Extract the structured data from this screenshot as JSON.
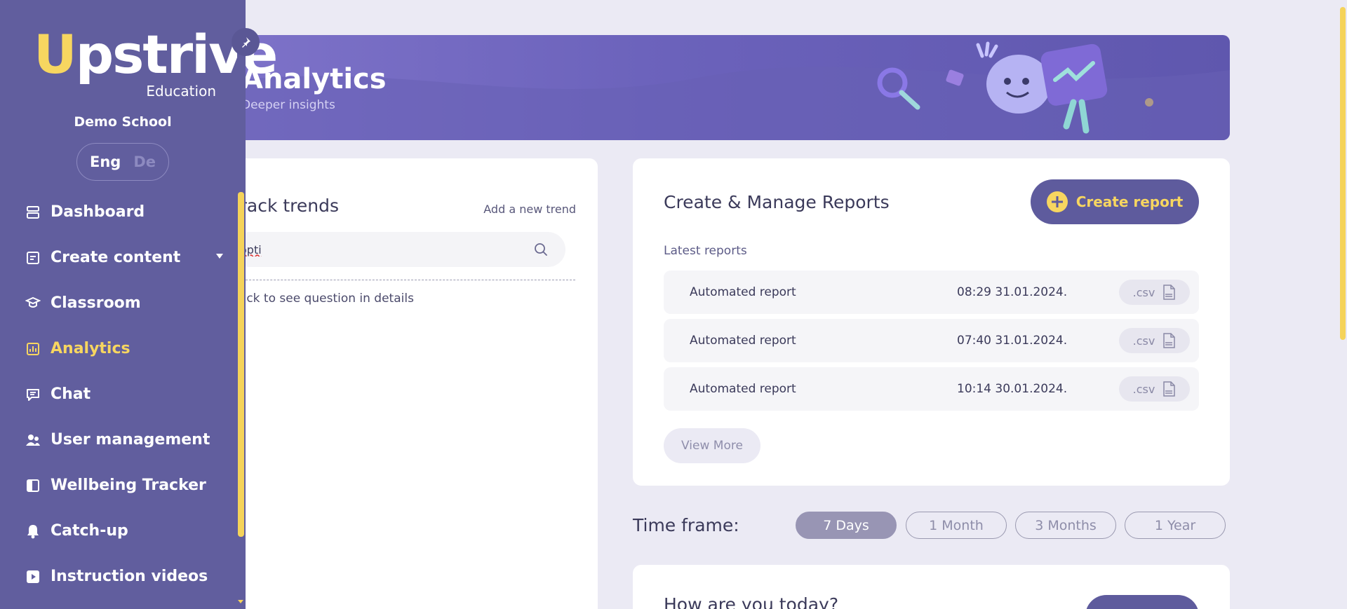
{
  "sidebar": {
    "logo": "Upstrive",
    "logo_sub": "Education",
    "school": "Demo School",
    "lang": {
      "eng": "Eng",
      "de": "De"
    },
    "items": [
      {
        "label": "Dashboard",
        "icon": "dashboard-icon"
      },
      {
        "label": "Create content",
        "icon": "create-content-icon"
      },
      {
        "label": "Classroom",
        "icon": "classroom-icon"
      },
      {
        "label": "Analytics",
        "icon": "analytics-icon"
      },
      {
        "label": "Chat",
        "icon": "chat-icon"
      },
      {
        "label": "User management",
        "icon": "user-management-icon"
      },
      {
        "label": "Wellbeing Tracker",
        "icon": "wellbeing-icon"
      },
      {
        "label": "Catch-up",
        "icon": "bell-icon"
      },
      {
        "label": "Instruction videos",
        "icon": "video-icon"
      }
    ],
    "active": "Analytics"
  },
  "banner": {
    "title": "Analytics",
    "subtitle": "Deeper insights"
  },
  "trends": {
    "title": "Track trends",
    "add_link": "Add a new trend",
    "search_value": "opti",
    "hint": "Click to see question in details"
  },
  "reports": {
    "title": "Create & Manage Reports",
    "create_label": "Create report",
    "latest_label": "Latest reports",
    "rows": [
      {
        "name": "Automated report",
        "time": "08:29 31.01.2024.",
        "format": ".csv"
      },
      {
        "name": "Automated report",
        "time": "07:40 31.01.2024.",
        "format": ".csv"
      },
      {
        "name": "Automated report",
        "time": "10:14 30.01.2024.",
        "format": ".csv"
      }
    ],
    "view_more": "View More"
  },
  "timeframe": {
    "label": "Time frame:",
    "options": [
      "7 Days",
      "1 Month",
      "3 Months",
      "1 Year"
    ],
    "selected": "7 Days"
  },
  "wellbeing": {
    "title": "How are you today?"
  },
  "colors": {
    "sidebar": "#615e9e",
    "accent": "#f7d660",
    "background": "#ebeaf4"
  }
}
